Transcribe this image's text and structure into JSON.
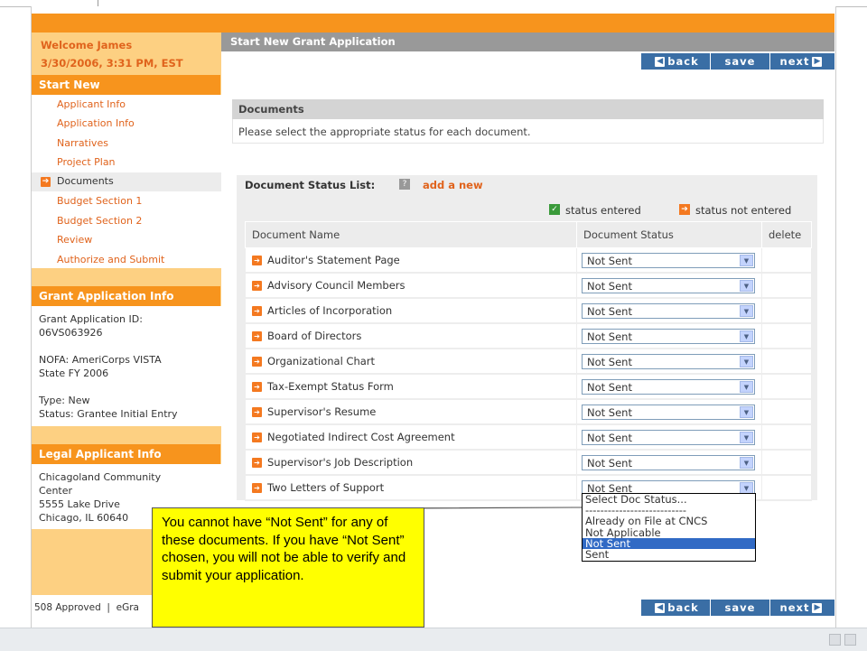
{
  "sidebar": {
    "welcome": "Welcome James",
    "datetime": "3/30/2006, 3:31 PM, EST",
    "start_new_heading": "Start New",
    "nav_items": [
      {
        "label": "Applicant Info"
      },
      {
        "label": "Application Info"
      },
      {
        "label": "Narratives"
      },
      {
        "label": "Project Plan"
      },
      {
        "label": "Documents"
      },
      {
        "label": "Budget Section 1"
      },
      {
        "label": "Budget Section 2"
      },
      {
        "label": "Review"
      },
      {
        "label": "Authorize and Submit"
      }
    ],
    "active_nav": "Documents",
    "grant_info": {
      "heading": "Grant Application Info",
      "id_label": "Grant Application ID:",
      "id_value": "06VS063926",
      "nofa": "NOFA: AmeriCorps VISTA",
      "state_fy": "State FY 2006",
      "type": "Type: New",
      "status": "Status: Grantee Initial Entry"
    },
    "legal_info": {
      "heading": "Legal Applicant Info",
      "line1": "Chicagoland Community",
      "line2": "Center",
      "line3": "5555 Lake Drive",
      "line4": "Chicago, IL 60640"
    },
    "footer": "508 Approved  |  eGra"
  },
  "main": {
    "header_title": "Start New Grant Application",
    "buttons": {
      "back": "back",
      "save": "save",
      "next": "next"
    },
    "documents_title": "Documents",
    "documents_instructions": "Please select the appropriate status for each document.",
    "status_list_title": "Document Status List:",
    "help_icon": "?",
    "add_new": "add a new",
    "legend_entered": "status entered",
    "legend_not_entered": "status not entered",
    "columns": {
      "name": "Document Name",
      "status": "Document Status",
      "delete": "delete"
    },
    "rows": [
      {
        "name": "Auditor's Statement Page",
        "status": "Not Sent"
      },
      {
        "name": "Advisory Council Members",
        "status": "Not Sent"
      },
      {
        "name": "Articles of Incorporation",
        "status": "Not Sent"
      },
      {
        "name": "Board of Directors",
        "status": "Not Sent"
      },
      {
        "name": "Organizational Chart",
        "status": "Not Sent"
      },
      {
        "name": "Tax-Exempt Status Form",
        "status": "Not Sent"
      },
      {
        "name": "Supervisor's Resume",
        "status": "Not Sent"
      },
      {
        "name": "Negotiated Indirect Cost Agreement",
        "status": "Not Sent"
      },
      {
        "name": "Supervisor's Job Description",
        "status": "Not Sent"
      },
      {
        "name": "Two Letters of Support",
        "status": "Not Sent"
      }
    ],
    "dropdown_options": [
      "Select Doc Status...",
      "---------------------------",
      "Already on File at CNCS",
      "Not Applicable",
      "Not Sent",
      "Sent"
    ],
    "dropdown_selected": "Not Sent"
  },
  "callout": {
    "text": "You cannot have “Not Sent” for any of these documents.  If you have “Not Sent” chosen, you will not be able to verify and submit your application."
  },
  "colors": {
    "orange": "#f7941d",
    "light_orange": "#fdd082",
    "button_blue": "#3a6ea5",
    "callout_yellow": "#ffff00"
  }
}
